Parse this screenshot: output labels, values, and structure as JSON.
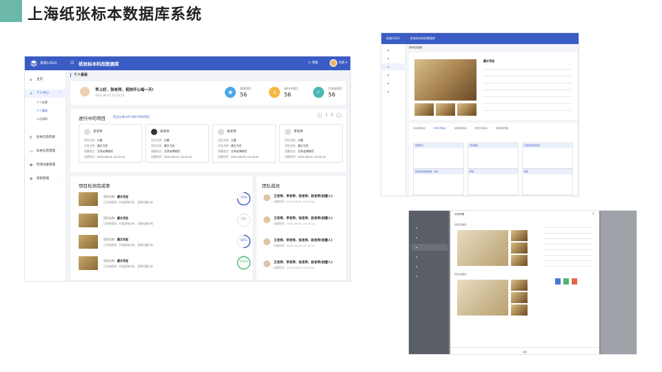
{
  "slide": {
    "title": "上海纸张标本数据库系统",
    "accent_color": "#6bb8a8"
  },
  "main": {
    "header": {
      "logo_text": "系统LOGO",
      "system_name": "纸张标本科技数据库",
      "refresh_label": "清查",
      "user_label": "刘某"
    },
    "sidebar": {
      "items": [
        {
          "label": "主页",
          "icon": "home-icon"
        },
        {
          "label": "个人中心",
          "icon": "user-icon"
        },
        {
          "label": "个人前置",
          "sub": true
        },
        {
          "label": "个人看板",
          "sub": true,
          "active": true
        },
        {
          "label": "公告通知",
          "sub": true
        },
        {
          "label": "标本信息检索",
          "icon": "search-icon"
        },
        {
          "label": "标本信息管理",
          "icon": "folder-icon"
        },
        {
          "label": "检测设备管理",
          "icon": "device-icon"
        },
        {
          "label": "系统管理",
          "icon": "gear-icon"
        }
      ]
    },
    "breadcrumb": "个人看板",
    "welcome": {
      "greeting": "早上好，张老师，祝你开心每一天!",
      "date": "2021-06-01 10:10:10"
    },
    "stats": [
      {
        "label": "浏览项目",
        "value": "56",
        "color": "#4aa8e8",
        "icon": "eye-icon"
      },
      {
        "label": "进行中项目",
        "value": "56",
        "color": "#f4b840",
        "icon": "user-icon"
      },
      {
        "label": "已完成项目",
        "value": "56",
        "color": "#4ab8b0",
        "icon": "check-icon"
      }
    ],
    "projects": {
      "title": "进行中的项目",
      "link": "您正在参与6个进行中的项目",
      "pages": [
        "1",
        "2"
      ],
      "items": [
        {
          "name": "李老师",
          "code_label": "项目名称：",
          "code": "古籍",
          "type_label": "项目名称：",
          "type": "藏文写经",
          "place_label": "馆藏地点：",
          "place": "甘肃省博物馆",
          "time_label": "创建时间：",
          "time": "2021-06-01 10:10:10"
        },
        {
          "name": "宋老师",
          "code_label": "项目名称：",
          "code": "古籍",
          "type_label": "项目名称：",
          "type": "藏文写经",
          "place_label": "馆藏地点：",
          "place": "甘肃省博物馆",
          "time_label": "创建时间：",
          "time": "2021-06-01 10:10:10"
        },
        {
          "name": "张老师",
          "code_label": "项目名称：",
          "code": "古籍",
          "type_label": "项目名称：",
          "type": "藏文写经",
          "place_label": "馆藏地点：",
          "place": "甘肃省博物馆",
          "time_label": "创建时间：",
          "time": "2021-06-01 10:10:10"
        },
        {
          "name": "李老师",
          "code_label": "项目名称：",
          "code": "古籍",
          "type_label": "项目名称：",
          "type": "藏文写经",
          "place_label": "馆藏地点：",
          "place": "甘肃省博物馆",
          "time_label": "创建时间：",
          "time": "2021-06-01 10:10:10"
        }
      ]
    },
    "completion": {
      "title": "项目检测完成率",
      "items": [
        {
          "name_label": "项目名称：",
          "name": "藏文写经",
          "desc": "已完成检测：纤维显微分析、显微拉曼分析",
          "rate": 0.75,
          "rate_label": "75%"
        },
        {
          "name_label": "项目名称：",
          "name": "藏文写经",
          "desc": "已完成检测：纤维显微分析、显微拉曼分析",
          "rate": 0,
          "rate_label": "0%"
        },
        {
          "name_label": "项目名称：",
          "name": "藏文写经",
          "desc": "已完成检测：纤维显微分析、显微拉曼分析",
          "rate": 0.5,
          "rate_label": "50%"
        },
        {
          "name_label": "项目名称：",
          "name": "藏文写经",
          "desc": "已完成检测：纤维显微分析、显微拉曼分析",
          "rate": 1,
          "rate_label": "100%"
        }
      ]
    },
    "team": {
      "title": "团队成员",
      "members": [
        {
          "names": "王老师、李老师、张老师、赵老师(创建人)",
          "time": "创建时间：2021-06-01 10:10:10"
        },
        {
          "names": "王老师、李老师、张老师、赵老师(创建人)",
          "time": "创建时间：2021-06-01 10:10:10"
        },
        {
          "names": "王老师、李老师、张老师、赵老师(创建人)",
          "time": "创建时间：2021-06-01 10:10:10"
        },
        {
          "names": "王老师、李老师、张老师、赵老师(创建人)",
          "time": "创建时间：2021-06-01 10:10:10"
        }
      ]
    }
  },
  "thumb_detail": {
    "header_logo": "系统LOGO",
    "header_name": "纸张标本科技数据库",
    "breadcrumb": "标本信息查看",
    "specimen_title": "藏文写经",
    "tabs": [
      "标本文物信息",
      "科学认知信息",
      "检测数据信息",
      "研究分析信息",
      "检测报告管理"
    ],
    "boxes": [
      "成纸形式",
      "纸张图像",
      "纤维形态检测(纸)",
      "纸张纹理测量数据，采样",
      "厚度",
      "造纸"
    ]
  },
  "thumb_dialog": {
    "title": "分析详情",
    "section1": "纸张显微图片",
    "section2": "纸张显微图片",
    "close": "×",
    "footer": "返回"
  }
}
